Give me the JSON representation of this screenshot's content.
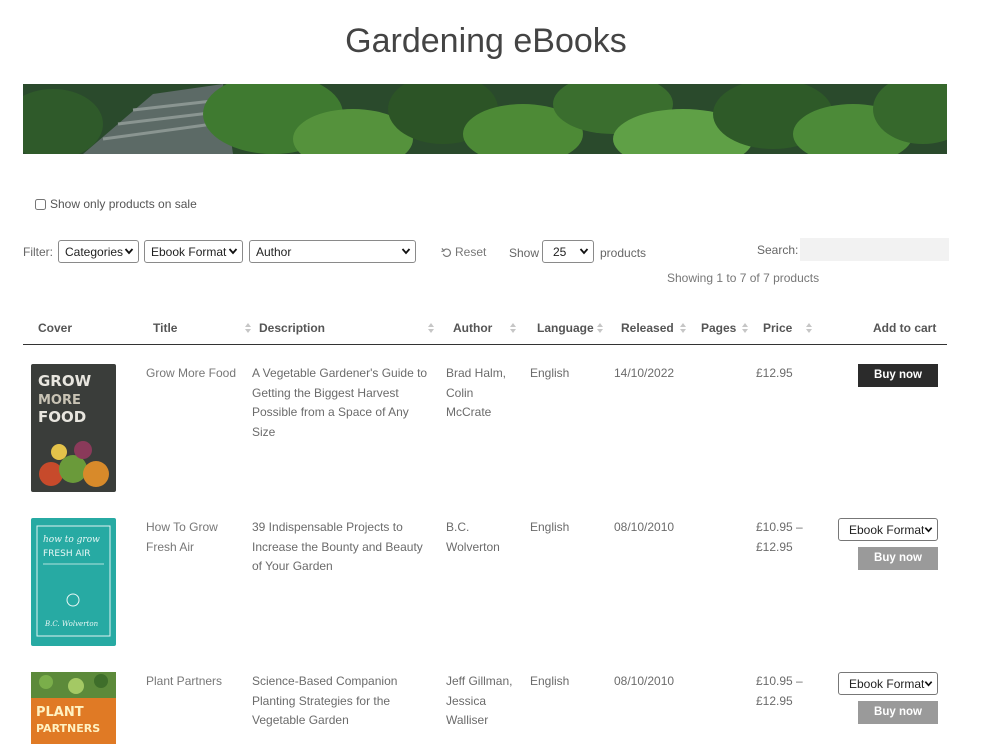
{
  "page": {
    "title": "Gardening eBooks"
  },
  "sale_filter": {
    "label": "Show only products on sale"
  },
  "filters": {
    "label": "Filter:",
    "categories": "Categories",
    "format": "Ebook Format",
    "author": "Author",
    "reset": "Reset",
    "show_label": "Show",
    "show_value": "25",
    "products_label": "products",
    "search_label": "Search:",
    "search_value": ""
  },
  "summary": "Showing 1 to 7 of 7 products",
  "table": {
    "headers": [
      "Cover",
      "Title",
      "Description",
      "Author",
      "Language",
      "Released",
      "Pages",
      "Price",
      "Add to cart"
    ],
    "rows": [
      {
        "cover_text": "GROW MORE FOOD",
        "title": "Grow More Food",
        "description": "A Vegetable Gardener's Guide to Getting the Biggest Harvest Possible from a Space of Any Size",
        "author": "Brad Halm, Colin McCrate",
        "language": "English",
        "released": "14/10/2022",
        "pages": "",
        "price": "£12.95",
        "button": "Buy now",
        "format_select": ""
      },
      {
        "cover_text": "how to grow FRESH AIR",
        "title": "How To Grow Fresh Air",
        "description": "39 Indispensable Projects to Increase the Bounty and Beauty of Your Garden",
        "author": "B.C. Wolverton",
        "language": "English",
        "released": "08/10/2010",
        "pages": "",
        "price": "£10.95 – £12.95",
        "button": "Buy now",
        "format_select": "Ebook Format"
      },
      {
        "cover_text": "PLANT PARTNERS",
        "title": "Plant Partners",
        "description": "Science-Based Companion Planting Strategies for the Vegetable Garden",
        "author": "Jeff Gillman, Jessica Walliser",
        "language": "English",
        "released": "08/10/2010",
        "pages": "",
        "price": "£10.95 – £12.95",
        "button": "Buy now",
        "format_select": "Ebook Format"
      }
    ]
  },
  "colors": {
    "buy_dark": "#2b2b2b",
    "buy_disabled": "#9a9a9a",
    "header_rule": "#333333"
  }
}
